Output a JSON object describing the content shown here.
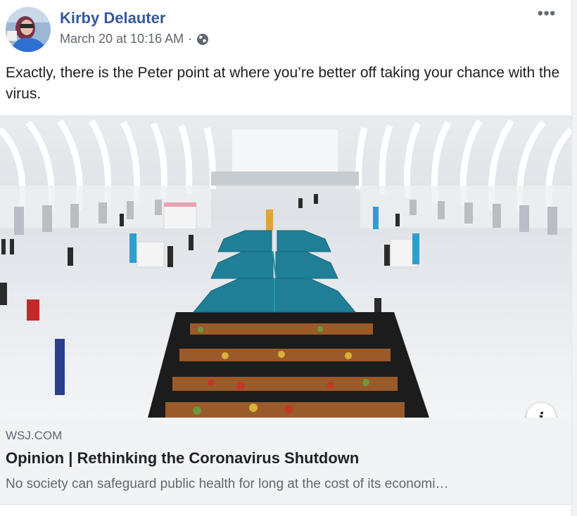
{
  "post": {
    "author": "Kirby Delauter",
    "timestamp": "March 20 at 10:16 AM",
    "separator": "·",
    "privacy_icon": "globe-icon",
    "more_label": "•••",
    "message": "Exactly, there is the Peter point at where you’re better off taking your chance with the virus."
  },
  "link_preview": {
    "domain": "WSJ.COM",
    "title": "Opinion | Rethinking the Coronavirus Shutdown",
    "description": "No society can safeguard public health for long at the cost of its economi…",
    "info_label": "i"
  },
  "colors": {
    "author_link": "#385898",
    "tent": "#1f7f96",
    "footer_bg": "#f2f3f5"
  }
}
